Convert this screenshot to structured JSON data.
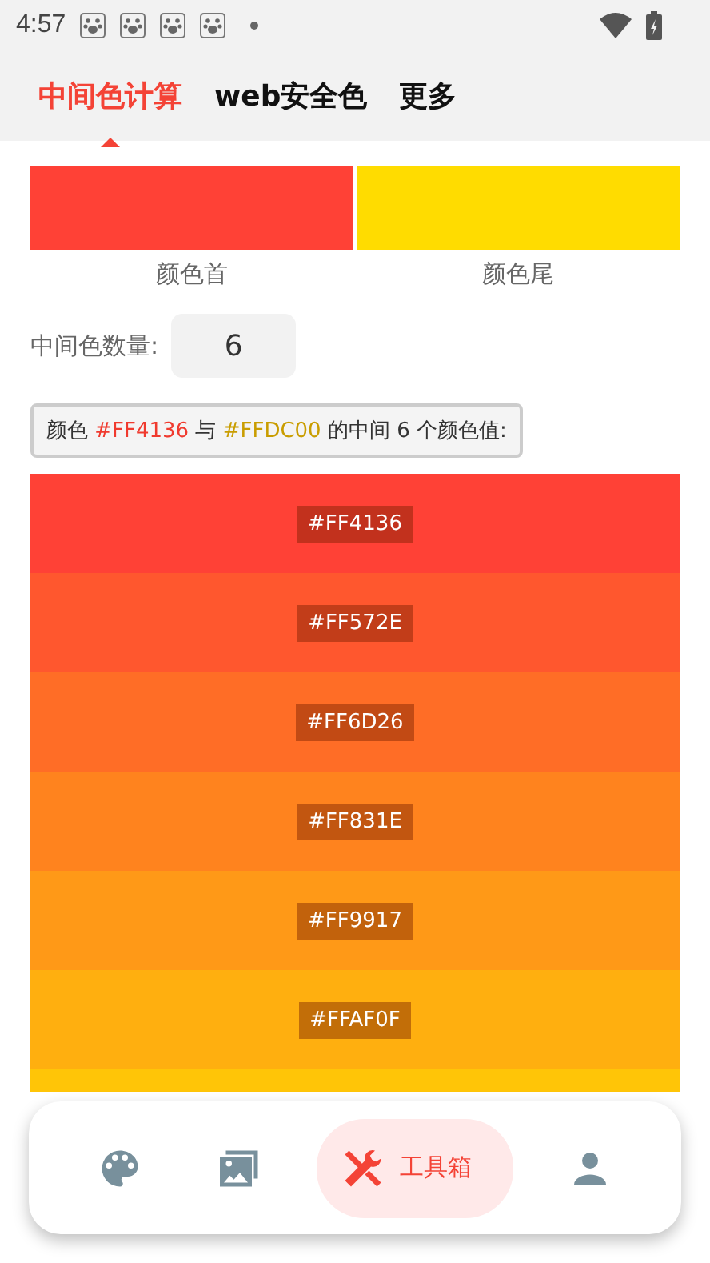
{
  "status_bar": {
    "time": "4:57"
  },
  "tabs": [
    {
      "label": "中间色计算",
      "selected": true
    },
    {
      "label": "web安全色",
      "selected": false
    },
    {
      "label": "更多",
      "selected": false
    }
  ],
  "endpoints": [
    {
      "label": "颜色首",
      "color": "#ff4136"
    },
    {
      "label": "颜色尾",
      "color": "#ffdc00"
    }
  ],
  "count": {
    "label": "中间色数量:",
    "value": "6"
  },
  "summary": {
    "prefix": "颜色",
    "from": "#FF4136",
    "joiner": "与",
    "to": "#FFDC00",
    "suffix": "的中间 6 个颜色值:"
  },
  "colors": [
    {
      "label": "#FF4136",
      "color": "#ff4136"
    },
    {
      "label": "#FF572E",
      "color": "#ff572e"
    },
    {
      "label": "#FF6D26",
      "color": "#ff6d26"
    },
    {
      "label": "#FF831E",
      "color": "#ff831e"
    },
    {
      "label": "#FF9917",
      "color": "#ff9917"
    },
    {
      "label": "#FFAF0F",
      "color": "#ffaf0f"
    },
    {
      "color": "#ffc507"
    }
  ],
  "bottom_nav": [
    {
      "kind": "palette",
      "selected": false
    },
    {
      "kind": "images",
      "selected": false
    },
    {
      "kind": "tools",
      "label": "工具箱",
      "selected": true
    },
    {
      "kind": "person",
      "selected": false
    }
  ]
}
